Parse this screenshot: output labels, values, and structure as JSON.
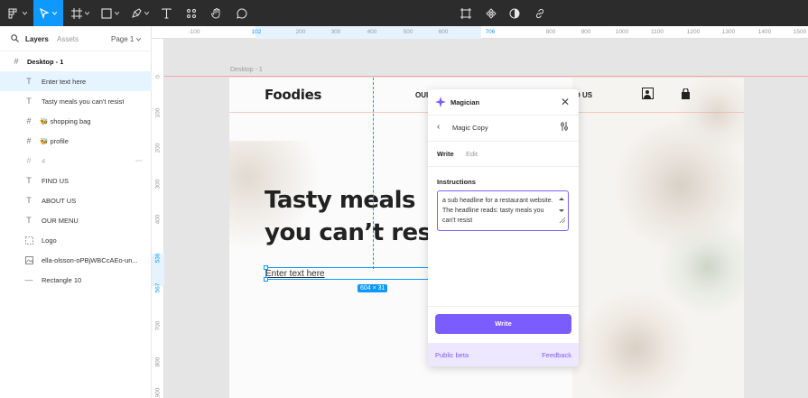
{
  "toolbar": {
    "tools": [
      "main-menu",
      "move",
      "frame",
      "shape",
      "pen",
      "text",
      "resources",
      "hand",
      "comment"
    ],
    "center_tools": [
      "components",
      "component-set",
      "contrast",
      "link"
    ],
    "accent": "#0d99ff"
  },
  "layers_panel": {
    "tab_layers": "Layers",
    "tab_assets": "Assets",
    "page_selector": "Page 1",
    "items": [
      {
        "label": "Desktop - 1",
        "icon": "frame-icon"
      },
      {
        "label": "Enter text here",
        "icon": "text-icon"
      },
      {
        "label": "Tasty meals you can't resist",
        "icon": "text-icon"
      },
      {
        "label": "shopping bag",
        "icon": "frame-icon"
      },
      {
        "label": "profile",
        "icon": "frame-icon"
      },
      {
        "label": "4",
        "icon": "frame-icon"
      },
      {
        "label": "FIND US",
        "icon": "text-icon"
      },
      {
        "label": "ABOUT US",
        "icon": "text-icon"
      },
      {
        "label": "OUR MENU",
        "icon": "text-icon"
      },
      {
        "label": "Logo",
        "icon": "group-icon"
      },
      {
        "label": "ella-olsson-oPBjWBCcAEo-un...",
        "icon": "image-icon"
      },
      {
        "label": "Rectangle 10",
        "icon": "line-icon"
      }
    ]
  },
  "ruler_top": [
    "-100",
    "102",
    "200",
    "300",
    "400",
    "500",
    "600",
    "706",
    "800",
    "900",
    "1000",
    "1100",
    "1200",
    "1300",
    "1400",
    "1500",
    "1600"
  ],
  "ruler_left": [
    "0",
    "100",
    "200",
    "300",
    "400",
    "536",
    "567",
    "700",
    "800",
    "900"
  ],
  "canvas": {
    "frame_label": "Desktop - 1",
    "logo_text": "Foodies",
    "nav_left": "OUI",
    "nav_right": "D US",
    "headline_line1": "Tasty meals",
    "headline_line2": "you can’t res",
    "selected_text": "Enter text here",
    "dimension_badge": "604 × 31"
  },
  "magician": {
    "title": "Magician",
    "subtitle": "Magic Copy",
    "tab_write": "Write",
    "tab_edit": "Edit",
    "instructions_label": "Instructions",
    "instructions_value": "a sub headline for a restaurant website. The headline reads: tasty meals you can't resist",
    "write_button": "Write",
    "footer_left": "Public beta",
    "footer_right": "Feedback",
    "accent": "#7b5cff"
  }
}
